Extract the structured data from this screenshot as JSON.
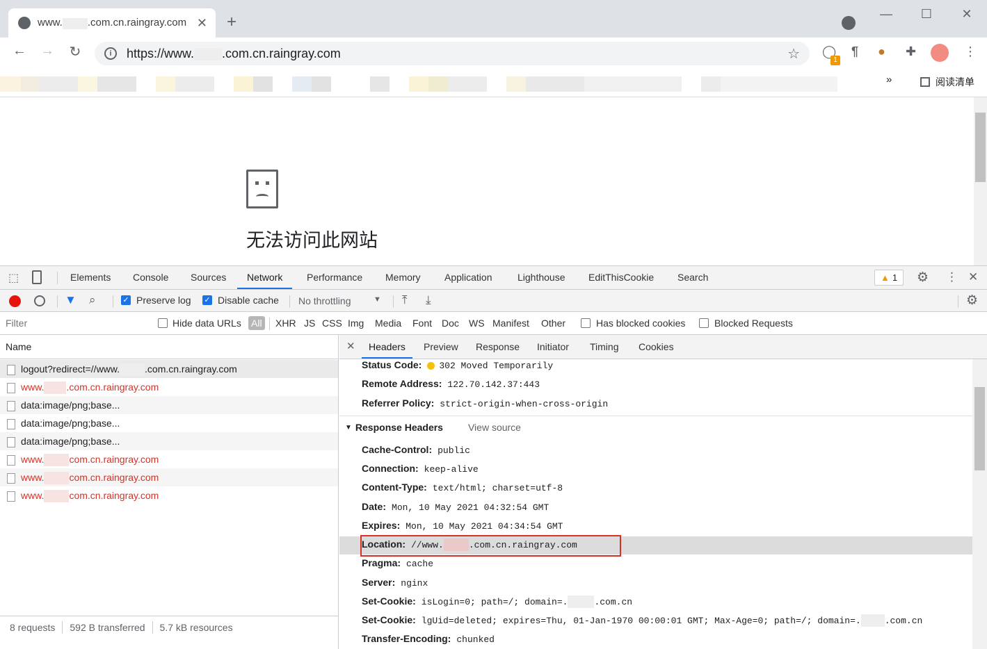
{
  "browser": {
    "tab_title": "www.",
    "tab_title_suffix": ".com.cn.raingray.com",
    "url_prefix": "https://www.",
    "url_suffix": ".com.cn.raingray.com",
    "ext_badge": "1",
    "reading_list": "阅读清单",
    "more_bookmarks": "»"
  },
  "page": {
    "error_title": "无法访问此网站"
  },
  "devtools": {
    "tabs": [
      "Elements",
      "Console",
      "Sources",
      "Network",
      "Performance",
      "Memory",
      "Application",
      "Lighthouse",
      "EditThisCookie",
      "Search"
    ],
    "active_tab": "Network",
    "warnings": "1",
    "toolbar": {
      "preserve_log": "Preserve log",
      "disable_cache": "Disable cache",
      "throttling": "No throttling"
    },
    "filter": {
      "placeholder": "Filter",
      "hide_data_urls": "Hide data URLs",
      "types": [
        "All",
        "XHR",
        "JS",
        "CSS",
        "Img",
        "Media",
        "Font",
        "Doc",
        "WS",
        "Manifest",
        "Other"
      ],
      "has_blocked_cookies": "Has blocked cookies",
      "blocked_requests": "Blocked Requests"
    },
    "name_header": "Name",
    "requests": [
      {
        "pre": "logout?redirect=//www.",
        "post": ".com.cn.raingray.com",
        "red": false
      },
      {
        "pre": "www.",
        "post": ".com.cn.raingray.com",
        "red": true
      },
      {
        "pre": "data:image/png;base...",
        "post": "",
        "red": false
      },
      {
        "pre": "data:image/png;base...",
        "post": "",
        "red": false
      },
      {
        "pre": "data:image/png;base...",
        "post": "",
        "red": false
      },
      {
        "pre": "www.",
        "post": "com.cn.raingray.com",
        "red": true
      },
      {
        "pre": "www.",
        "post": "com.cn.raingray.com",
        "red": true
      },
      {
        "pre": "www.",
        "post": "com.cn.raingray.com",
        "red": true
      }
    ],
    "status": {
      "requests": "8 requests",
      "transferred": "592 B transferred",
      "resources": "5.7 kB resources"
    },
    "detail_tabs": [
      "Headers",
      "Preview",
      "Response",
      "Initiator",
      "Timing",
      "Cookies"
    ],
    "general": [
      {
        "k": "Status Code:",
        "v": "302 Moved Temporarily"
      },
      {
        "k": "Remote Address:",
        "v": "122.70.142.37:443"
      },
      {
        "k": "Referrer Policy:",
        "v": "strict-origin-when-cross-origin"
      }
    ],
    "response_headers_title": "Response Headers",
    "view_source": "View source",
    "response_headers": [
      {
        "k": "Cache-Control:",
        "v": "public"
      },
      {
        "k": "Connection:",
        "v": "keep-alive"
      },
      {
        "k": "Content-Type:",
        "v": "text/html; charset=utf-8"
      },
      {
        "k": "Date:",
        "v": "Mon, 10 May 2021 04:32:54 GMT"
      },
      {
        "k": "Expires:",
        "v": "Mon, 10 May 2021 04:34:54 GMT"
      },
      {
        "k": "Location:",
        "v": "//www.",
        "v2": ".com.cn.raingray.com"
      },
      {
        "k": "Pragma:",
        "v": "cache"
      },
      {
        "k": "Server:",
        "v": "nginx"
      },
      {
        "k": "Set-Cookie:",
        "v": "isLogin=0; path=/; domain=.",
        "v2": ".com.cn"
      },
      {
        "k": "Set-Cookie:",
        "v": "lgUid=deleted; expires=Thu, 01-Jan-1970 00:00:01 GMT; Max-Age=0; path=/; domain=.",
        "v2": ".com.cn"
      },
      {
        "k": "Transfer-Encoding:",
        "v": "chunked"
      }
    ],
    "colors": {
      "accent": "#1a73e8",
      "error": "#d93025",
      "highlight": "#d93025"
    }
  }
}
